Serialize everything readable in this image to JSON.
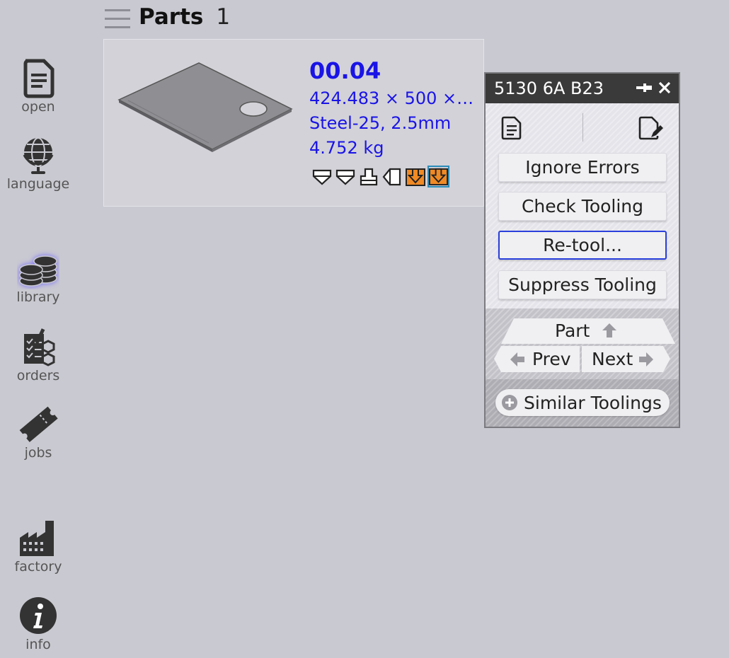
{
  "sidebar": {
    "items": [
      {
        "label": "open",
        "icon": "document-icon"
      },
      {
        "label": "language",
        "icon": "globe-icon"
      },
      {
        "label": "library",
        "icon": "coin-stack-icon"
      },
      {
        "label": "orders",
        "icon": "checklist-icon"
      },
      {
        "label": "jobs",
        "icon": "ticket-icon"
      },
      {
        "label": "factory",
        "icon": "factory-icon"
      },
      {
        "label": "info",
        "icon": "info-icon"
      }
    ]
  },
  "header": {
    "title": "Parts",
    "count": "1"
  },
  "part": {
    "number": "00.04",
    "dimensions": "424.483 × 500 ×…",
    "material": "Steel-25, 2.5mm",
    "weight": "4.752 kg"
  },
  "panel": {
    "title": "5130 6A B23",
    "buttons": {
      "ignore_errors": "Ignore Errors",
      "check_tooling": "Check Tooling",
      "retool": "Re-tool...",
      "suppress_tooling": "Suppress Tooling"
    },
    "nav": {
      "part": "Part",
      "prev": "Prev",
      "next": "Next"
    },
    "similar": "Similar Toolings"
  },
  "colors": {
    "background": "#c9c9d1",
    "accent_blue": "#1a14e6",
    "tool_orange": "#f08a24",
    "panel_title_bg": "#3a3a3a"
  }
}
